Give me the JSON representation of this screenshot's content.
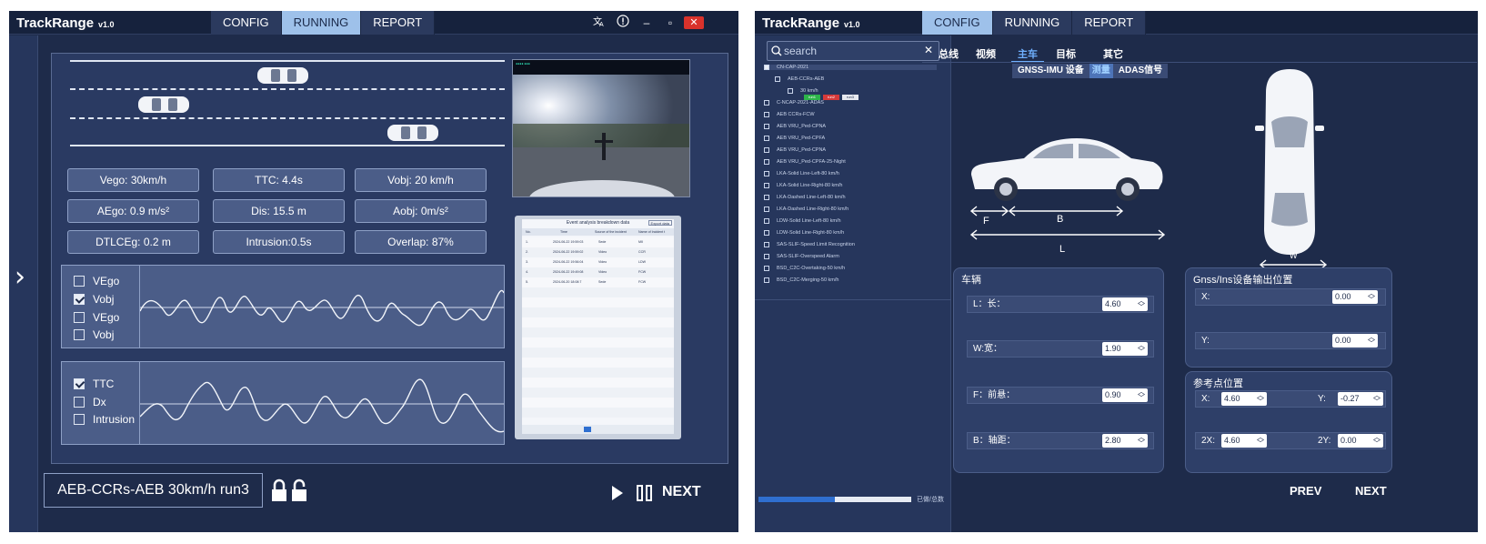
{
  "left_window": {
    "brand": "TrackRange",
    "version": "v1.0",
    "tabs": [
      "CONFIG",
      "RUNNING",
      "REPORT"
    ],
    "active_tab": "RUNNING",
    "metrics": [
      "Vego:  30km/h",
      "TTC: 4.4s",
      "Vobj: 20  km/h",
      "AEgo: 0.9 m/s²",
      "Dis: 15.5 m",
      "Aobj:  0m/s²",
      "DTLCEg: 0.2 m",
      "Intrusion:0.5s",
      "Overlap: 87%"
    ],
    "chart1_legend": [
      {
        "label": "VEgo",
        "checked": false
      },
      {
        "label": "Vobj",
        "checked": true
      },
      {
        "label": "VEgo",
        "checked": false
      },
      {
        "label": "Vobj",
        "checked": false
      }
    ],
    "chart2_legend": [
      {
        "label": "TTC",
        "checked": true
      },
      {
        "label": "Dx",
        "checked": false
      },
      {
        "label": "Intrusion",
        "checked": false
      }
    ],
    "report_title": "Event analysis breakdown data",
    "report_export": "Export data",
    "report_columns": [
      "No.",
      "Time",
      "Source of the incident",
      "Name of Incident t"
    ],
    "report_rows": [
      [
        "1.",
        "2024-06-22 19:59:03",
        "Sede",
        "MII"
      ],
      [
        "2.",
        "2024-06-22 19:59:02",
        "Video",
        "CCR"
      ],
      [
        "3.",
        "2024-06-22 19:56:04",
        "Video",
        "LDW"
      ],
      [
        "4.",
        "2024-06-22 19:49:08",
        "Video",
        "FCW"
      ],
      [
        "5.",
        "2024-06-20 18:08:7",
        "Sede",
        "FCW"
      ]
    ],
    "scenario": "AEB-CCRs-AEB 30km/h run3",
    "next_label": "NEXT"
  },
  "right_window": {
    "brand": "TrackRange",
    "version": "v1.0",
    "tabs": [
      "CONFIG",
      "RUNNING",
      "REPORT"
    ],
    "active_tab": "CONFIG",
    "search_placeholder": "search",
    "tree_items": [
      {
        "label": "CN-CAP-2021",
        "checked": true,
        "level": 0
      },
      {
        "label": "AEB-CCRs-AEB",
        "checked": false,
        "level": 1
      },
      {
        "label": "30 km/h",
        "checked": false,
        "level": 2
      },
      {
        "label": "C-NCAP-2021-ADAS",
        "checked": false,
        "level": 0
      },
      {
        "label": "AEB CCRs-FCW",
        "checked": false,
        "level": 0
      },
      {
        "label": "AEB VRU_Ped-CPNA",
        "checked": false,
        "level": 0
      },
      {
        "label": "AEB VRU_Ped-CPFA",
        "checked": false,
        "level": 0
      },
      {
        "label": "AEB VRU_Ped-CPNA",
        "checked": false,
        "level": 0
      },
      {
        "label": "AEB VRU_Ped-CPFA-25-Night",
        "checked": false,
        "level": 0
      },
      {
        "label": "LKA-Solid Line-Left-80 km/h",
        "checked": false,
        "level": 0
      },
      {
        "label": "LKA-Solid Line-Right-80 km/h",
        "checked": false,
        "level": 0
      },
      {
        "label": "LKA-Dashed Line-Left-80 km/h",
        "checked": false,
        "level": 0
      },
      {
        "label": "LKA-Dashed Line-Right-80 km/h",
        "checked": false,
        "level": 0
      },
      {
        "label": "LDW-Solid Line-Left-80 km/h",
        "checked": false,
        "level": 0
      },
      {
        "label": "LDW-Solid Line-Right-80 km/h",
        "checked": false,
        "level": 0
      },
      {
        "label": "SAS-SLIF-Speed Limit Recognition",
        "checked": false,
        "level": 0
      },
      {
        "label": "SAS-SLIF-Overspeed Alarm",
        "checked": false,
        "level": 0
      },
      {
        "label": "BSD_C2C-Overtaking-50 km/h",
        "checked": false,
        "level": 0
      },
      {
        "label": "BSD_C2C-Merging-50 km/h",
        "checked": false,
        "level": 0
      }
    ],
    "run_tags": [
      "run1",
      "run2",
      "run3"
    ],
    "progress_label": "已做/总数",
    "progress": 0.5,
    "subtabs": [
      "总线",
      "视频",
      "主车",
      "目标",
      "其它"
    ],
    "active_subtab": "主车",
    "subsubtabs": [
      "GNSS-IMU 设备",
      "测量",
      "ADAS信号"
    ],
    "active_subsubtab": "测量",
    "dim_labels": {
      "F": "F",
      "B": "B",
      "L": "L",
      "W": "W"
    },
    "vehicle_group": {
      "title": "车辆",
      "fields": [
        {
          "label": "L：长：",
          "value": "4.60"
        },
        {
          "label": "W:宽：",
          "value": "1.90"
        },
        {
          "label": "F：前悬：",
          "value": "0.90"
        },
        {
          "label": "B：轴距：",
          "value": "2.80"
        }
      ]
    },
    "gnss_group": {
      "title": "Gnss/Ins设备输出位置",
      "fields": [
        {
          "label": "X:",
          "value": "0.00"
        },
        {
          "label": "Y:",
          "value": "0.00"
        }
      ]
    },
    "ref_group": {
      "title": "参考点位置",
      "x_label": "X:",
      "x_value": "4.60",
      "y_label": "Y:",
      "y_value": "-0.27",
      "x2_label": "2X:",
      "x2_value": "4.60",
      "y2_label": "2Y:",
      "y2_value": "0.00"
    },
    "prev_label": "PREV",
    "next_label": "NEXT"
  },
  "colors": {
    "background": "#1e2b4a",
    "active_tab": "#9ec1ea",
    "panel": "#4b5d88",
    "close": "#d9322b"
  }
}
